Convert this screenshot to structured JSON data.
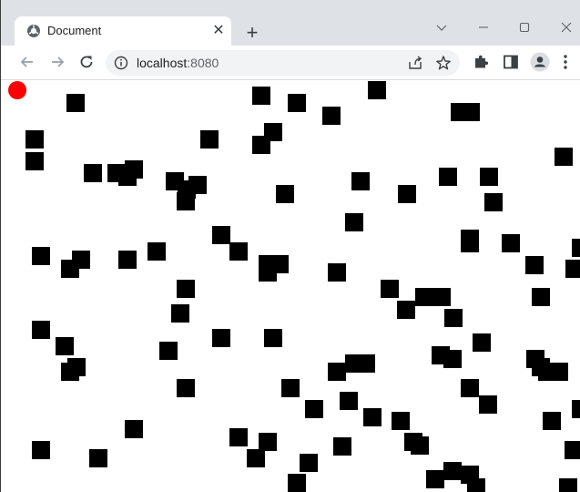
{
  "tab": {
    "title": "Document",
    "close_icon": "close-icon",
    "favicon": "globe-icon"
  },
  "omnibox": {
    "host": "localhost",
    "port": ":8080"
  },
  "colors": {
    "player": "#ff0000",
    "obstacle": "#000000"
  }
}
